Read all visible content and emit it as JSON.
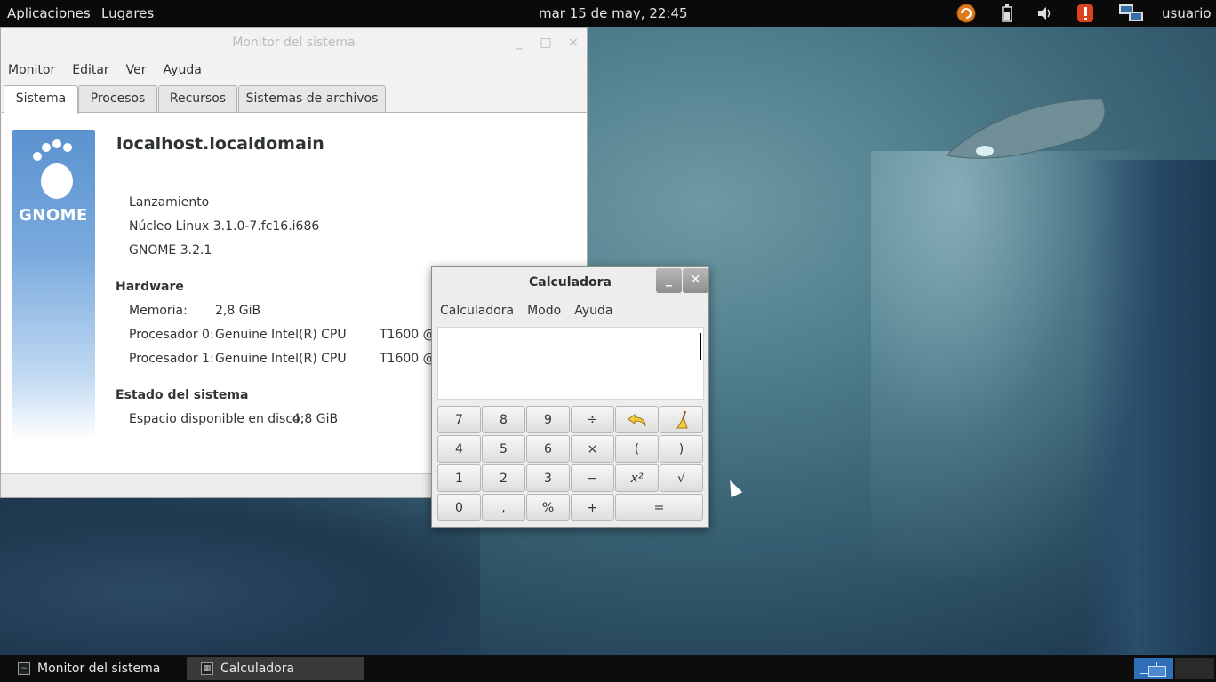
{
  "top_panel": {
    "applications": "Aplicaciones",
    "places": "Lugares",
    "clock": "mar 15 de may, 22:45",
    "user": "usuario",
    "tray_icons": [
      "update-icon",
      "battery-icon",
      "volume-icon",
      "alert-icon",
      "network-icon"
    ]
  },
  "sysmon": {
    "title": "Monitor del sistema",
    "window_buttons": {
      "minimize": "_",
      "maximize": "□",
      "close": "×"
    },
    "menu": [
      "Monitor",
      "Editar",
      "Ver",
      "Ayuda"
    ],
    "tabs": [
      "Sistema",
      "Procesos",
      "Recursos",
      "Sistemas de archivos"
    ],
    "logo_text": "GNOME",
    "hostname": "localhost.localdomain",
    "release": "Lanzamiento",
    "kernel": "Núcleo Linux 3.1.0-7.fc16.i686",
    "gnome_version": "GNOME 3.2.1",
    "hardware_header": "Hardware",
    "memory_label": "Memoria:",
    "memory_value": "2,8 GiB",
    "cpu0_label": "Procesador 0:",
    "cpu0_value": "Genuine Intel(R) CPU",
    "cpu0_model": "T1600  @",
    "cpu1_label": "Procesador 1:",
    "cpu1_value": "Genuine Intel(R) CPU",
    "cpu1_model": "T1600  @",
    "status_header": "Estado del sistema",
    "disk_label": "Espacio disponible en disco:",
    "disk_value": "4,8 GiB"
  },
  "calc": {
    "title": "Calculadora",
    "window_buttons": {
      "minimize": "_",
      "close": "✕"
    },
    "menu": [
      "Calculadora",
      "Modo",
      "Ayuda"
    ],
    "display_value": "",
    "keys": {
      "k7": "7",
      "k8": "8",
      "k9": "9",
      "divide": "÷",
      "undo": "↶",
      "clear": "🧹",
      "k4": "4",
      "k5": "5",
      "k6": "6",
      "multiply": "×",
      "lparen": "(",
      "rparen": ")",
      "k1": "1",
      "k2": "2",
      "k3": "3",
      "minus": "−",
      "square": "x²",
      "sqrt": "√",
      "k0": "0",
      "comma": ",",
      "percent": "%",
      "plus": "+",
      "equals": "="
    }
  },
  "taskbar": {
    "tasks": [
      "Monitor del sistema",
      "Calculadora"
    ]
  }
}
